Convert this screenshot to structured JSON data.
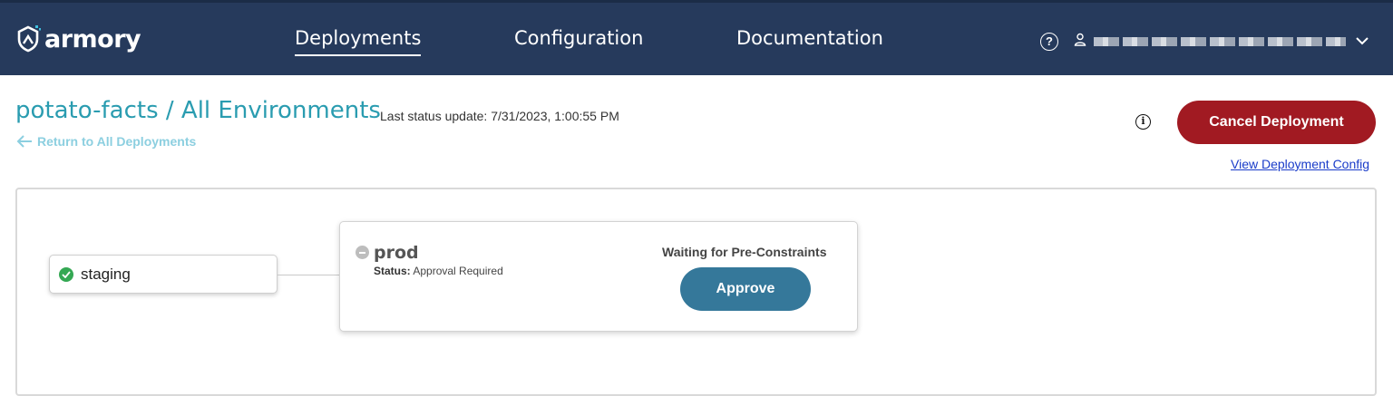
{
  "header": {
    "logo_text": "armory",
    "nav": [
      {
        "label": "Deployments",
        "active": true
      },
      {
        "label": "Configuration",
        "active": false
      },
      {
        "label": "Documentation",
        "active": false
      }
    ],
    "help_icon": "question-circle-icon",
    "user_icon": "user-icon"
  },
  "page": {
    "title": "potato-facts / All Environments",
    "last_status_update": "Last status update: 7/31/2023, 1:00:55 PM",
    "back_link": "Return to All Deployments",
    "cancel_button": "Cancel Deployment",
    "view_config_link": "View Deployment Config"
  },
  "pipeline": {
    "nodes": [
      {
        "name": "staging",
        "state": "success"
      },
      {
        "name": "prod",
        "status_label": "Status:",
        "status_value": "Approval Required",
        "waiting_text": "Waiting for Pre-Constraints",
        "action_label": "Approve",
        "state": "pending"
      }
    ]
  },
  "colors": {
    "navbar": "#263a5c",
    "title": "#2a9cb0",
    "cancel": "#a11a22",
    "approve": "#35789a",
    "success": "#34a853"
  }
}
